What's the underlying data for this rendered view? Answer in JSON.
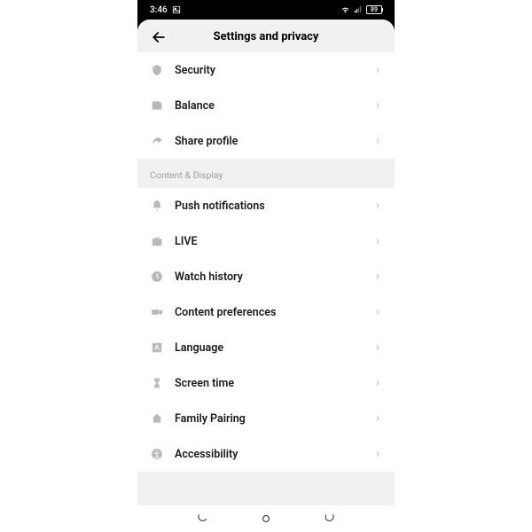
{
  "status": {
    "time": "3:46",
    "battery": "89"
  },
  "header": {
    "title": "Settings and privacy"
  },
  "section1": {
    "items": [
      {
        "label": "Security"
      },
      {
        "label": "Balance"
      },
      {
        "label": "Share profile"
      }
    ]
  },
  "section2": {
    "title": "Content & Display",
    "items": [
      {
        "label": "Push notifications"
      },
      {
        "label": "LIVE"
      },
      {
        "label": "Watch history"
      },
      {
        "label": "Content preferences"
      },
      {
        "label": "Language"
      },
      {
        "label": "Screen time"
      },
      {
        "label": "Family Pairing"
      },
      {
        "label": "Accessibility"
      }
    ]
  }
}
